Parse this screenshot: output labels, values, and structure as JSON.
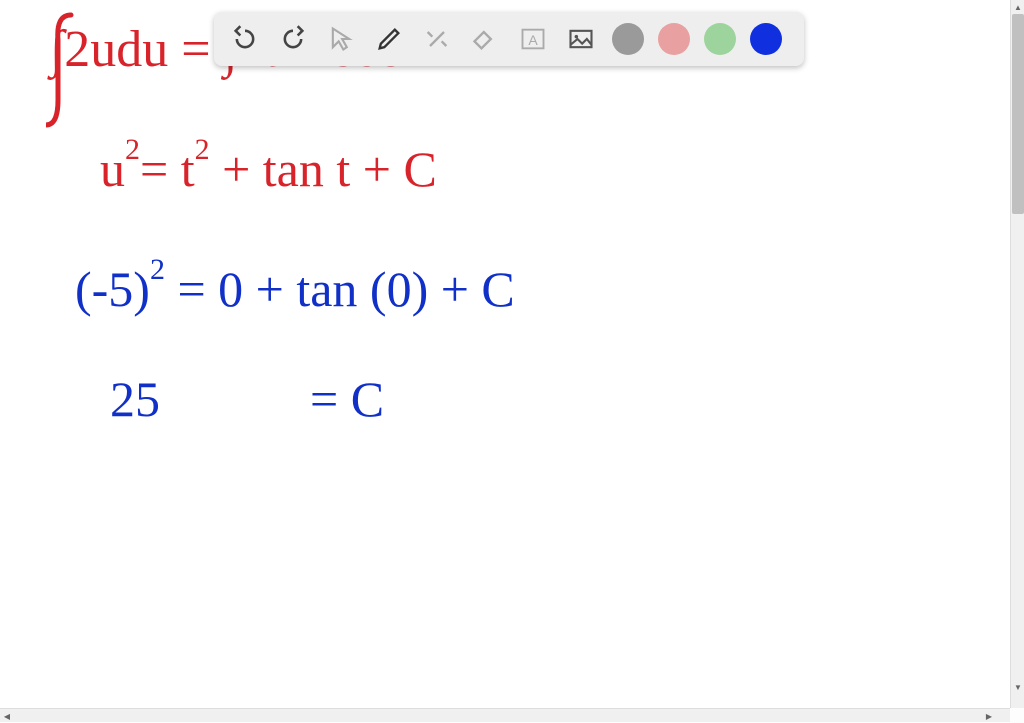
{
  "toolbar": {
    "undo": "undo",
    "redo": "redo",
    "pointer": "pointer",
    "pen": "pen",
    "tools": "tools",
    "eraser": "eraser",
    "textbox": "A",
    "image": "image",
    "colors": {
      "gray": "#9a9a9a",
      "pink": "#e8a0a0",
      "green": "#9dd49d",
      "blue": "#1030e0"
    }
  },
  "handwriting": {
    "line1": "∫2udu = ∫2t   + sec",
    "line2_a": "u",
    "line2_exp": "2",
    "line2_b": "=  t",
    "line2_exp2": "2",
    "line2_c": " +  tan t  + C",
    "line3_a": "(-5)",
    "line3_exp": "2",
    "line3_b": " =  0  +  tan (0) + C",
    "line4_a": "25",
    "line4_b": "=  C"
  }
}
